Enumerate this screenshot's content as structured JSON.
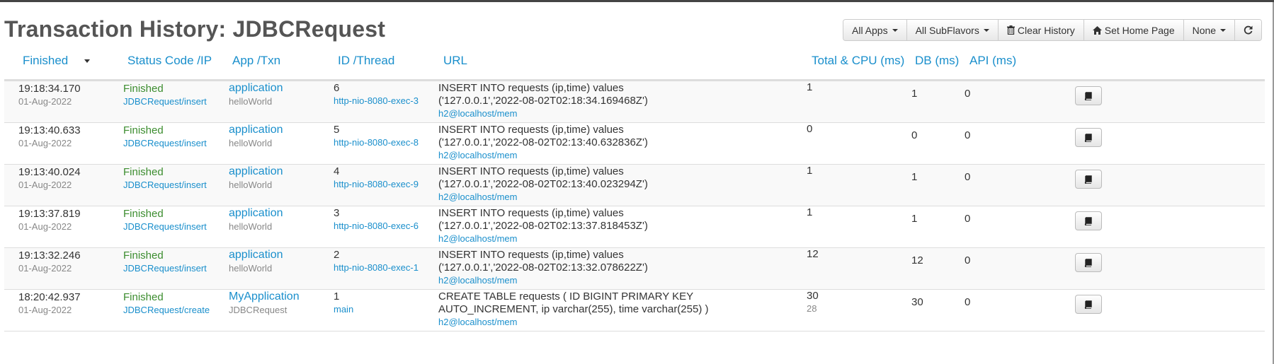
{
  "page": {
    "title": "Transaction History: JDBCRequest"
  },
  "toolbar": {
    "all_apps": "All Apps",
    "all_subflavors": "All SubFlavors",
    "clear_history": "Clear History",
    "set_home_page": "Set Home Page",
    "none": "None",
    "icons": {
      "clear_history": "trash-icon",
      "set_home_page": "home-icon",
      "refresh": "refresh-icon"
    }
  },
  "table": {
    "headers": {
      "finished": "Finished",
      "status": "Status Code /IP",
      "app": "App /Txn",
      "id": "ID /Thread",
      "url": "URL",
      "total": "Total & CPU (ms)",
      "db": "DB (ms)",
      "api": "API (ms)"
    },
    "sort": {
      "column": "Finished",
      "direction": "descending"
    },
    "rows": [
      {
        "time": "19:18:34.170",
        "date": "01-Aug-2022",
        "status": "Finished",
        "request": "JDBCRequest/insert",
        "app": "application",
        "txn": "helloWorld",
        "id": "6",
        "thread": "http-nio-8080-exec-3",
        "sql1": "INSERT INTO requests (ip,time) values",
        "sql2": "('127.0.0.1','2022-08-02T02:18:34.169468Z')",
        "db_url": "h2@localhost/mem",
        "total": "1",
        "cpu": "",
        "db": "1",
        "api": "0"
      },
      {
        "time": "19:13:40.633",
        "date": "01-Aug-2022",
        "status": "Finished",
        "request": "JDBCRequest/insert",
        "app": "application",
        "txn": "helloWorld",
        "id": "5",
        "thread": "http-nio-8080-exec-8",
        "sql1": "INSERT INTO requests (ip,time) values",
        "sql2": "('127.0.0.1','2022-08-02T02:13:40.632836Z')",
        "db_url": "h2@localhost/mem",
        "total": "0",
        "cpu": "",
        "db": "0",
        "api": "0"
      },
      {
        "time": "19:13:40.024",
        "date": "01-Aug-2022",
        "status": "Finished",
        "request": "JDBCRequest/insert",
        "app": "application",
        "txn": "helloWorld",
        "id": "4",
        "thread": "http-nio-8080-exec-9",
        "sql1": "INSERT INTO requests (ip,time) values",
        "sql2": "('127.0.0.1','2022-08-02T02:13:40.023294Z')",
        "db_url": "h2@localhost/mem",
        "total": "1",
        "cpu": "",
        "db": "1",
        "api": "0"
      },
      {
        "time": "19:13:37.819",
        "date": "01-Aug-2022",
        "status": "Finished",
        "request": "JDBCRequest/insert",
        "app": "application",
        "txn": "helloWorld",
        "id": "3",
        "thread": "http-nio-8080-exec-6",
        "sql1": "INSERT INTO requests (ip,time) values",
        "sql2": "('127.0.0.1','2022-08-02T02:13:37.818453Z')",
        "db_url": "h2@localhost/mem",
        "total": "1",
        "cpu": "",
        "db": "1",
        "api": "0"
      },
      {
        "time": "19:13:32.246",
        "date": "01-Aug-2022",
        "status": "Finished",
        "request": "JDBCRequest/insert",
        "app": "application",
        "txn": "helloWorld",
        "id": "2",
        "thread": "http-nio-8080-exec-1",
        "sql1": "INSERT INTO requests (ip,time) values",
        "sql2": "('127.0.0.1','2022-08-02T02:13:32.078622Z')",
        "db_url": "h2@localhost/mem",
        "total": "12",
        "cpu": "",
        "db": "12",
        "api": "0"
      },
      {
        "time": "18:20:42.937",
        "date": "01-Aug-2022",
        "status": "Finished",
        "request": "JDBCRequest/create",
        "app": "MyApplication",
        "txn": "JDBCRequest",
        "id": "1",
        "thread": "main",
        "sql1": "CREATE TABLE requests ( ID BIGINT PRIMARY KEY",
        "sql2": "AUTO_INCREMENT, ip varchar(255), time varchar(255) )",
        "db_url": "h2@localhost/mem",
        "total": "30",
        "cpu": "28",
        "db": "30",
        "api": "0"
      }
    ],
    "row_action_icon": "book-icon"
  },
  "colors": {
    "link": "#1a8fcc",
    "status_ok": "#3c8d2f",
    "title": "#555555"
  }
}
